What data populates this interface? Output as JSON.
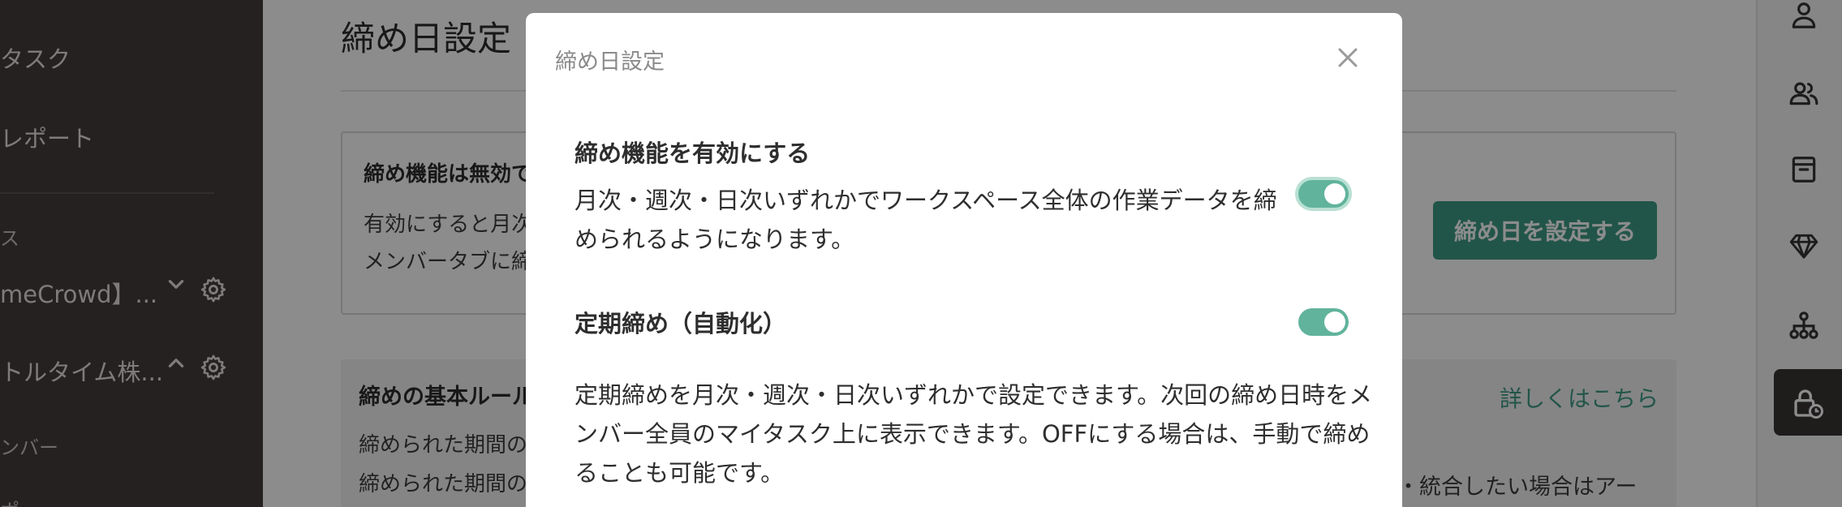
{
  "sidebar": {
    "items": [
      {
        "label": "タスク"
      },
      {
        "label": "レポート"
      }
    ],
    "section_label": "ス",
    "workspaces": [
      {
        "label": "meCrowd】..."
      },
      {
        "label": "トルタイム株..."
      }
    ],
    "sub_label": "ンバー",
    "cut_label": "ポ"
  },
  "page": {
    "title": "締め日設定",
    "card": {
      "heading": "締め機能は無効で",
      "lines": [
        "有効にすると月次",
        "メンバータブに締"
      ],
      "button": "締め日を設定する"
    },
    "rules": {
      "heading": "締めの基本ルール",
      "link": "詳しくはこちら",
      "lines": [
        "締められた期間の",
        "締められた期間の"
      ],
      "tail": "・統合したい場合はアー"
    }
  },
  "modal": {
    "title": "締め日設定",
    "section1": {
      "heading": "締め機能を有効にする",
      "desc_lines": [
        "月次・週次・日次いずれかでワークスペース全体の作業データを締",
        "められるようになります。"
      ],
      "toggle_on": true
    },
    "section2": {
      "heading": "定期締め（自動化）",
      "toggle_on": true,
      "desc_lines": [
        "定期締めを月次・週次・日次いずれかで設定できます。次回の締め日時をメ",
        "ンバー全員のマイタスク上に表示できます。OFFにする場合は、手動で締め",
        "ることも可能です。"
      ]
    }
  },
  "colors": {
    "accent": "#3f9c86",
    "toggle": "#61b39c",
    "sidebar": "#453d3d"
  },
  "right_icons": [
    "person-icon",
    "people-icon",
    "archive-icon",
    "diamond-icon",
    "org-chart-icon",
    "lock-clock-icon"
  ]
}
